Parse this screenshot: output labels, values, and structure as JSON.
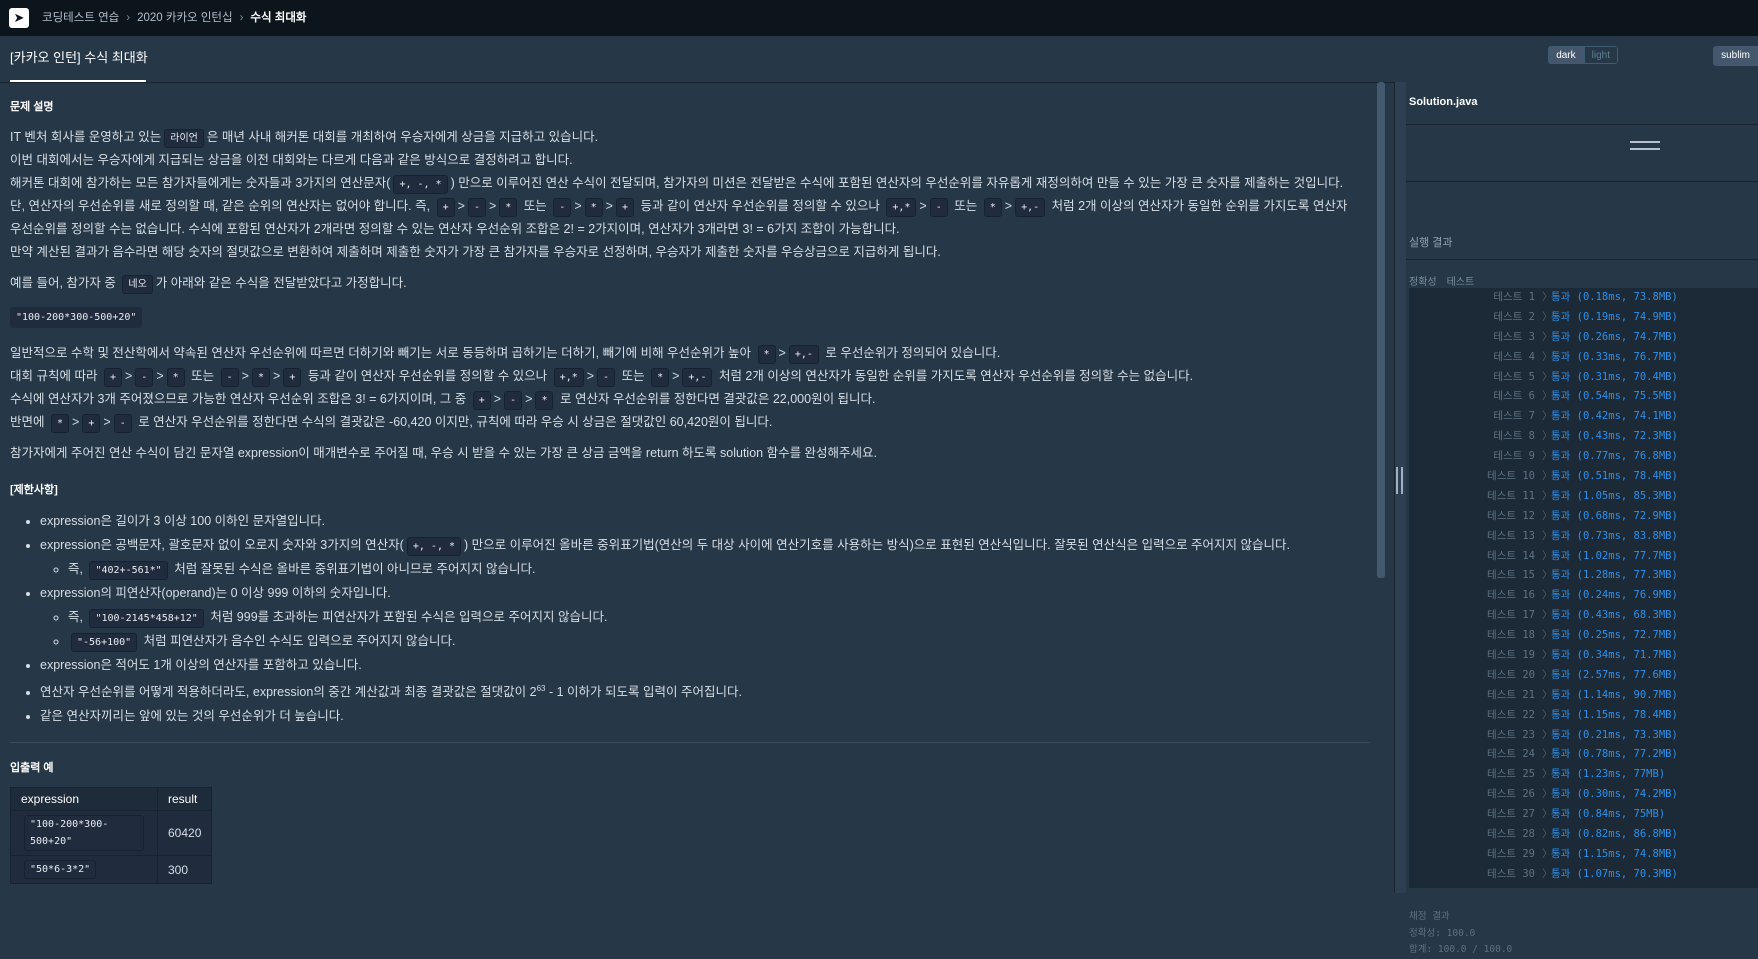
{
  "breadcrumb": [
    "코딩테스트 연습",
    "2020 카카오 인턴십",
    "수식 최대화"
  ],
  "title": "[카카오 인턴] 수식 최대화",
  "theme_options": [
    "dark",
    "light"
  ],
  "theme2": "sublim",
  "description": {
    "heading": "문제 설명",
    "p1a": "IT 벤처 회사를 운영하고 있는",
    "p1code": "라이언",
    "p1b": "은 매년 사내 해커톤 대회를 개최하여 우승자에게 상금을 지급하고 있습니다.",
    "p2": "이번 대회에서는 우승자에게 지급되는 상금을 이전 대회와는 다르게 다음과 같은 방식으로 결정하려고 합니다.",
    "p3a": "해커톤 대회에 참가하는 모든 참가자들에게는 숫자들과 3가지의 연산문자(",
    "p3code": "+, -, *",
    "p3b": ") 만으로 이루어진 연산 수식이 전달되며, 참가자의 미션은 전달받은 수식에 포함된 연산자의 우선순위를 자유롭게 재정의하여 만들 수 있는 가장 큰 숫자를 제출하는 것입니다.",
    "p4a": "단, 연산자의 우선순위를 새로 정의할 때, 같은 순위의 연산자는 없어야 합니다. 즉,",
    "p4b": "또는",
    "p4c": "등과 같이 연산자 우선순위를 정의할 수 있으나",
    "p4d": "또는",
    "p4e": "처럼 2개 이상의 연산자가 동일한 순위를 가지도록 연산자",
    "p5": "우선순위를 정의할 수는 없습니다. 수식에 포함된 연산자가 2개라면 정의할 수 있는 연산자 우선순위 조합은 2! = 2가지이며, 연산자가 3개라면 3! = 6가지 조합이 가능합니다.",
    "p6": "만약 계산된 결과가 음수라면 해당 숫자의 절댓값으로 변환하여 제출하며 제출한 숫자가 가장 큰 참가자를 우승자로 선정하며, 우승자가 제출한 숫자를 우승상금으로 지급하게 됩니다.",
    "p7a": "예를 들어, 참가자 중",
    "p7code": "네오",
    "p7b": "가 아래와 같은 수식을 전달받았다고 가정합니다.",
    "example_expr": "\"100-200*300-500+20\"",
    "p8a": "일반적으로 수학 및 전산학에서 약속된 연산자 우선순위에 따르면 더하기와 빼기는 서로 동등하며 곱하기는 더하기, 빼기에 비해 우선순위가 높아",
    "p8b": "로 우선순위가 정의되어 있습니다.",
    "p9a": "대회 규칙에 따라",
    "p9b": "또는",
    "p9c": "등과 같이 연산자 우선순위를 정의할 수 있으나",
    "p9d": "또는",
    "p9e": "처럼 2개 이상의 연산자가 동일한 순위를 가지도록 연산자 우선순위를 정의할 수는 없습니다.",
    "p10a": "수식에 연산자가 3개 주어졌으므로 가능한 연산자 우선순위 조합은 3! = 6가지이며, 그 중",
    "p10b": "로 연산자 우선순위를 정한다면 결괏값은 22,000원이 됩니다.",
    "p11a": "반면에",
    "p11b": "로 연산자 우선순위를 정한다면 수식의 결괏값은 -60,420 이지만, 규칙에 따라 우승 시 상금은 절댓값인 60,420원이 됩니다.",
    "p12": "참가자에게 주어진 연산 수식이 담긴 문자열 expression이 매개변수로 주어질 때, 우승 시 받을 수 있는 가장 큰 상금 금액을 return 하도록 solution 함수를 완성해주세요."
  },
  "ops": {
    "plus": "+",
    "minus": "-",
    "mul": "*",
    "gt": ">",
    "plus_mul": "+,*",
    "plus_minus": "+,-"
  },
  "constraints": {
    "heading": "[제한사항]",
    "c1": "expression은 길이가 3 이상 100 이하인 문자열입니다.",
    "c2a": "expression은 공백문자, 괄호문자 없이 오로지 숫자와 3가지의 연산자(",
    "c2code": "+, -, *",
    "c2b": ") 만으로 이루어진 올바른 중위표기법(연산의 두 대상 사이에 연산기호를 사용하는 방식)으로 표현된 연산식입니다. 잘못된 연산식은 입력으로 주어지지 않습니다.",
    "c2s_a": "즉,",
    "c2s_code": "\"402+-561*\"",
    "c2s_b": "처럼 잘못된 수식은 올바른 중위표기법이 아니므로 주어지지 않습니다.",
    "c3": "expression의 피연산자(operand)는 0 이상 999 이하의 숫자입니다.",
    "c3s1_a": "즉,",
    "c3s1_code": "\"100-2145*458+12\"",
    "c3s1_b": "처럼 999를 초과하는 피연산자가 포함된 수식은 입력으로 주어지지 않습니다.",
    "c3s2_code": "\"-56+100\"",
    "c3s2_b": "처럼 피연산자가 음수인 수식도 입력으로 주어지지 않습니다.",
    "c4": "expression은 적어도 1개 이상의 연산자를 포함하고 있습니다.",
    "c5a": "연산자 우선순위를 어떻게 적용하더라도, expression의 중간 계산값과 최종 결괏값은 절댓값이 2",
    "c5sup": "63",
    "c5b": " - 1 이하가 되도록 입력이 주어집니다.",
    "c6": "같은 연산자끼리는 앞에 있는 것의 우선순위가 더 높습니다."
  },
  "io": {
    "heading": "입출력 예",
    "headers": [
      "expression",
      "result"
    ],
    "rows": [
      [
        "\"100-200*300-500+20\"",
        "60420"
      ],
      [
        "\"50*6-3*2\"",
        "300"
      ]
    ]
  },
  "editor": {
    "filename": "Solution.java"
  },
  "run": {
    "tab": "실행 결과",
    "subtabs": [
      "정확성",
      "테스트"
    ],
    "tests": [
      {
        "name": "테스트 1",
        "result": "통과 (0.18ms, 73.8MB)"
      },
      {
        "name": "테스트 2",
        "result": "통과 (0.19ms, 74.9MB)"
      },
      {
        "name": "테스트 3",
        "result": "통과 (0.26ms, 74.7MB)"
      },
      {
        "name": "테스트 4",
        "result": "통과 (0.33ms, 76.7MB)"
      },
      {
        "name": "테스트 5",
        "result": "통과 (0.31ms, 70.4MB)"
      },
      {
        "name": "테스트 6",
        "result": "통과 (0.54ms, 75.5MB)"
      },
      {
        "name": "테스트 7",
        "result": "통과 (0.42ms, 74.1MB)"
      },
      {
        "name": "테스트 8",
        "result": "통과 (0.43ms, 72.3MB)"
      },
      {
        "name": "테스트 9",
        "result": "통과 (0.77ms, 76.8MB)"
      },
      {
        "name": "테스트 10",
        "result": "통과 (0.51ms, 78.4MB)"
      },
      {
        "name": "테스트 11",
        "result": "통과 (1.05ms, 85.3MB)"
      },
      {
        "name": "테스트 12",
        "result": "통과 (0.68ms, 72.9MB)"
      },
      {
        "name": "테스트 13",
        "result": "통과 (0.73ms, 83.8MB)"
      },
      {
        "name": "테스트 14",
        "result": "통과 (1.02ms, 77.7MB)"
      },
      {
        "name": "테스트 15",
        "result": "통과 (1.28ms, 77.3MB)"
      },
      {
        "name": "테스트 16",
        "result": "통과 (0.24ms, 76.9MB)"
      },
      {
        "name": "테스트 17",
        "result": "통과 (0.43ms, 68.3MB)"
      },
      {
        "name": "테스트 18",
        "result": "통과 (0.25ms, 72.7MB)"
      },
      {
        "name": "테스트 19",
        "result": "통과 (0.34ms, 71.7MB)"
      },
      {
        "name": "테스트 20",
        "result": "통과 (2.57ms, 77.6MB)"
      },
      {
        "name": "테스트 21",
        "result": "통과 (1.14ms, 90.7MB)"
      },
      {
        "name": "테스트 22",
        "result": "통과 (1.15ms, 78.4MB)"
      },
      {
        "name": "테스트 23",
        "result": "통과 (0.21ms, 73.3MB)"
      },
      {
        "name": "테스트 24",
        "result": "통과 (0.78ms, 77.2MB)"
      },
      {
        "name": "테스트 25",
        "result": "통과 (1.23ms, 77MB)"
      },
      {
        "name": "테스트 26",
        "result": "통과 (0.30ms, 74.2MB)"
      },
      {
        "name": "테스트 27",
        "result": "통과 (0.84ms, 75MB)"
      },
      {
        "name": "테스트 28",
        "result": "통과 (0.82ms, 86.8MB)"
      },
      {
        "name": "테스트 29",
        "result": "통과 (1.15ms, 74.8MB)"
      },
      {
        "name": "테스트 30",
        "result": "통과 (1.07ms, 70.3MB)"
      }
    ],
    "grading_title": "채점 결과",
    "accuracy": "정확성: 100.0",
    "total": "합계: 100.0 / 100.0"
  }
}
